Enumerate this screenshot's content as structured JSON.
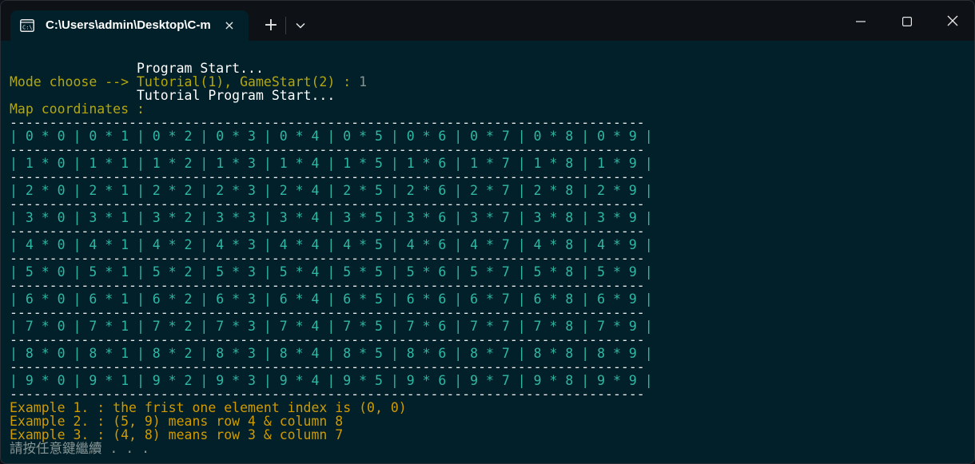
{
  "titlebar": {
    "tab_title": "C:\\Users\\admin\\Desktop\\C-m",
    "close_tab_glyph": "×",
    "new_tab_glyph": "+",
    "dropdown_glyph": "﹀",
    "minimize_glyph": "—",
    "maximize_glyph": "☐",
    "close_glyph": "✕",
    "icons": [
      "terminal-icon",
      "close-icon",
      "plus-icon",
      "chevron-down-icon",
      "minimize-icon",
      "maximize-icon",
      "close-window-icon"
    ]
  },
  "terminal": {
    "line1": "                Program Start...",
    "line2_prompt": "Mode choose --> ",
    "line2_options": "Tutorial(1), GameStart(2) : ",
    "line2_input": "1",
    "line3": "                Tutorial Program Start...",
    "line4": "Map coordinates :",
    "separator": "--------------------------------------------------------------------------------",
    "rows": [
      "| 0 * 0 | 0 * 1 | 0 * 2 | 0 * 3 | 0 * 4 | 0 * 5 | 0 * 6 | 0 * 7 | 0 * 8 | 0 * 9 |",
      "| 1 * 0 | 1 * 1 | 1 * 2 | 1 * 3 | 1 * 4 | 1 * 5 | 1 * 6 | 1 * 7 | 1 * 8 | 1 * 9 |",
      "| 2 * 0 | 2 * 1 | 2 * 2 | 2 * 3 | 2 * 4 | 2 * 5 | 2 * 6 | 2 * 7 | 2 * 8 | 2 * 9 |",
      "| 3 * 0 | 3 * 1 | 3 * 2 | 3 * 3 | 3 * 4 | 3 * 5 | 3 * 6 | 3 * 7 | 3 * 8 | 3 * 9 |",
      "| 4 * 0 | 4 * 1 | 4 * 2 | 4 * 3 | 4 * 4 | 4 * 5 | 4 * 6 | 4 * 7 | 4 * 8 | 4 * 9 |",
      "| 5 * 0 | 5 * 1 | 5 * 2 | 5 * 3 | 5 * 4 | 5 * 5 | 5 * 6 | 5 * 7 | 5 * 8 | 5 * 9 |",
      "| 6 * 0 | 6 * 1 | 6 * 2 | 6 * 3 | 6 * 4 | 6 * 5 | 6 * 6 | 6 * 7 | 6 * 8 | 6 * 9 |",
      "| 7 * 0 | 7 * 1 | 7 * 2 | 7 * 3 | 7 * 4 | 7 * 5 | 7 * 6 | 7 * 7 | 7 * 8 | 7 * 9 |",
      "| 8 * 0 | 8 * 1 | 8 * 2 | 8 * 3 | 8 * 4 | 8 * 5 | 8 * 6 | 8 * 7 | 8 * 8 | 8 * 9 |",
      "| 9 * 0 | 9 * 1 | 9 * 2 | 9 * 3 | 9 * 4 | 9 * 5 | 9 * 6 | 9 * 7 | 9 * 8 | 9 * 9 |"
    ],
    "example1": "Example 1. : the frist one element index is (0, 0)",
    "example2": "Example 2. : (5, 9) means row 4 & column 8",
    "example3": "Example 3. : (4, 8) means row 3 & column 7",
    "pause": "請按任意鍵繼續 . . ."
  },
  "colors": {
    "background": "#012029",
    "titlebar": "#0e1116",
    "olive": "#b5a70b",
    "teal": "#2fb7a5",
    "orange": "#d19a00"
  }
}
